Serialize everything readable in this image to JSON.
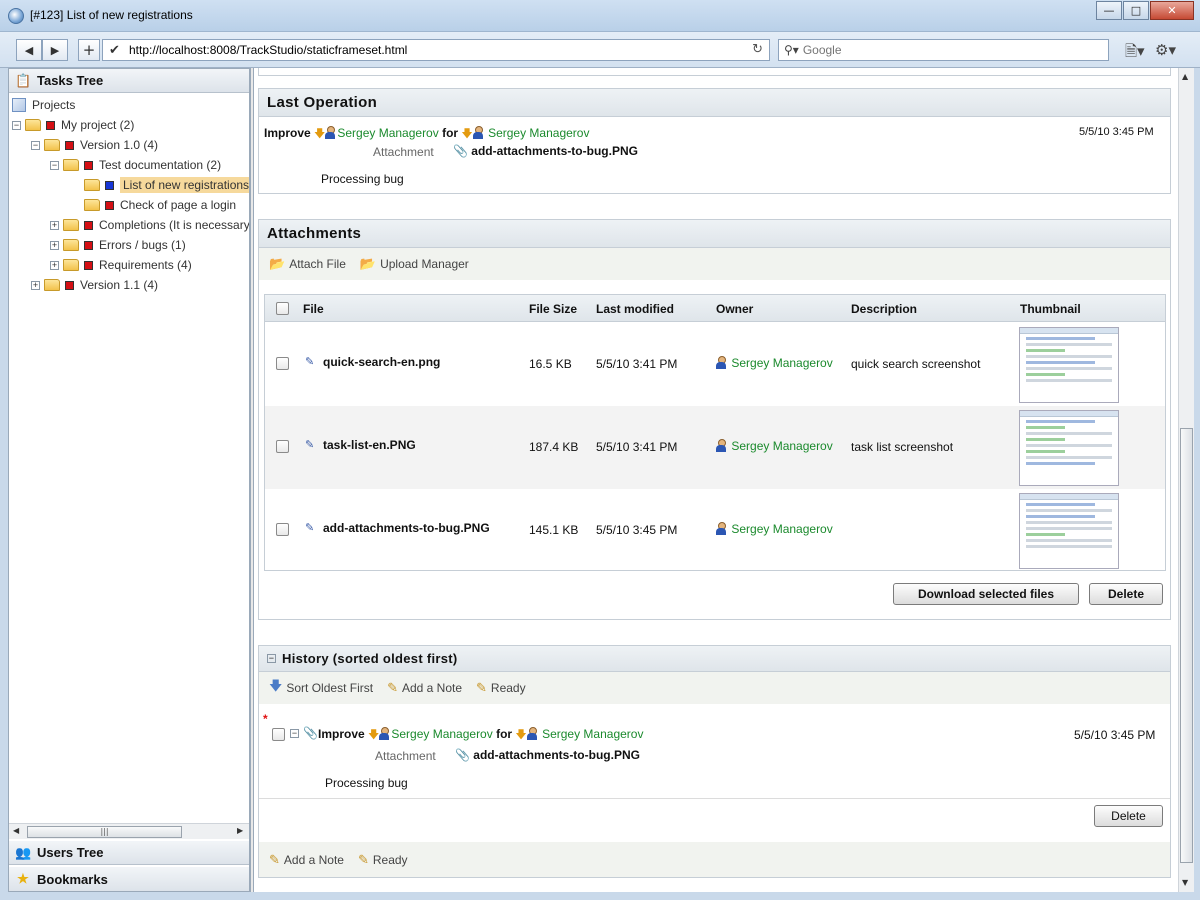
{
  "window": {
    "title": "[#123] List of new registrations"
  },
  "browser": {
    "url": "http://localhost:8008/TrackStudio/staticframeset.html",
    "search_placeholder": "Google"
  },
  "left": {
    "tasks_tree_header": "Tasks Tree",
    "tree": [
      {
        "label": "Projects",
        "level": 0
      },
      {
        "label": "My project (2)",
        "level": 1
      },
      {
        "label": "Version 1.0 (4)",
        "level": 2
      },
      {
        "label": "Test documentation (2)",
        "level": 3
      },
      {
        "label": "List of new registrations",
        "level": 4,
        "selected": true
      },
      {
        "label": "Check of page a login",
        "level": 4
      },
      {
        "label": "Completions (It is necessary",
        "level": 3
      },
      {
        "label": "Errors / bugs (1)",
        "level": 3
      },
      {
        "label": "Requirements (4)",
        "level": 3
      },
      {
        "label": "Version 1.1 (4)",
        "level": 2
      }
    ],
    "users_tree_header": "Users Tree",
    "bookmarks_header": "Bookmarks"
  },
  "last_operation": {
    "title": "Last Operation",
    "action": "Improve",
    "from_user": "Sergey Managerov",
    "for_label": "for",
    "to_user": "Sergey Managerov",
    "timestamp": "5/5/10 3:45 PM",
    "attachment_label": "Attachment",
    "attachment_file": "add-attachments-to-bug.PNG",
    "comment": "Processing bug"
  },
  "attachments": {
    "title": "Attachments",
    "attach_file": "Attach File",
    "upload_manager": "Upload Manager",
    "columns": {
      "file": "File",
      "size": "File Size",
      "modified": "Last modified",
      "owner": "Owner",
      "description": "Description",
      "thumbnail": "Thumbnail"
    },
    "rows": [
      {
        "file": "quick-search-en.png",
        "size": "16.5 KB",
        "modified": "5/5/10 3:41 PM",
        "owner": "Sergey Managerov",
        "description": "quick search screenshot"
      },
      {
        "file": "task-list-en.PNG",
        "size": "187.4 KB",
        "modified": "5/5/10 3:41 PM",
        "owner": "Sergey Managerov",
        "description": "task list screenshot"
      },
      {
        "file": "add-attachments-to-bug.PNG",
        "size": "145.1 KB",
        "modified": "5/5/10 3:45 PM",
        "owner": "Sergey Managerov",
        "description": ""
      }
    ],
    "download_btn": "Download selected files",
    "delete_btn": "Delete"
  },
  "history": {
    "title": "History (sorted oldest first)",
    "sort_oldest": "Sort Oldest First",
    "add_note": "Add a Note",
    "ready": "Ready",
    "entry": {
      "marker": "*",
      "action": "Improve",
      "from_user": "Sergey Managerov",
      "for_label": "for",
      "to_user": "Sergey Managerov",
      "timestamp": "5/5/10 3:45 PM",
      "attachment_label": "Attachment",
      "attachment_file": "add-attachments-to-bug.PNG",
      "comment": "Processing bug"
    },
    "delete_btn": "Delete",
    "footer_add_note": "Add a Note",
    "footer_ready": "Ready"
  }
}
